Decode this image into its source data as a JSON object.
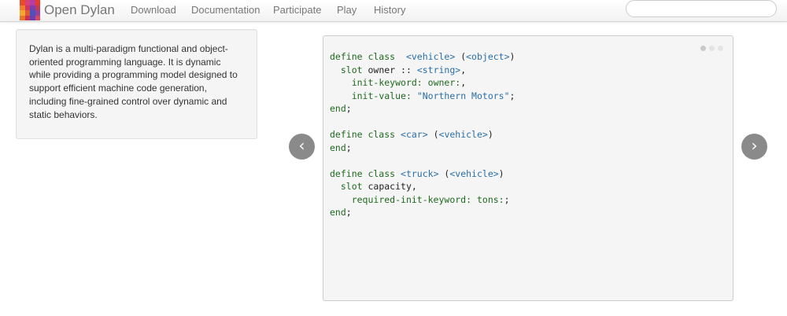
{
  "nav": {
    "brand": "Open Dylan",
    "links": [
      "Download",
      "Documentation",
      "Participate",
      "Play",
      "History"
    ],
    "search_placeholder": ""
  },
  "logo_colors": [
    "#e64b2c",
    "#d93f79",
    "#b43fa0",
    "#e8392d",
    "#f07c30",
    "#d2385e",
    "#7a3fae",
    "#c13c5a",
    "#f2a52f",
    "#e05a3a",
    "#4a54b4",
    "#9a3f9b",
    "#e7762a",
    "#c9334f",
    "#6d3fb5",
    "#d84863"
  ],
  "description": "Dylan is a multi-paradigm functional and object-oriented programming language. It is dynamic while providing a programming model designed to support efficient machine code generation, including fine-grained control over dynamic and static behaviors.",
  "code": {
    "lines": [
      [
        [
          "k",
          "define class"
        ],
        [
          "",
          "  "
        ],
        [
          "t",
          "<vehicle>"
        ],
        [
          "",
          " ("
        ],
        [
          "t",
          "<object>"
        ],
        [
          "",
          ")"
        ]
      ],
      [
        [
          "",
          "  "
        ],
        [
          "k",
          "slot"
        ],
        [
          "",
          " owner :: "
        ],
        [
          "t",
          "<string>"
        ],
        [
          "",
          ","
        ]
      ],
      [
        [
          "",
          "    "
        ],
        [
          "k",
          "init-keyword:"
        ],
        [
          "",
          " "
        ],
        [
          "k",
          "owner:"
        ],
        [
          "",
          ","
        ]
      ],
      [
        [
          "",
          "    "
        ],
        [
          "k",
          "init-value:"
        ],
        [
          "",
          " "
        ],
        [
          "s",
          "\"Northern Motors\""
        ],
        [
          "",
          ";"
        ]
      ],
      [
        [
          "k",
          "end"
        ],
        [
          "",
          ";"
        ]
      ],
      [
        [
          "",
          ""
        ]
      ],
      [
        [
          "k",
          "define class"
        ],
        [
          "",
          " "
        ],
        [
          "t",
          "<car>"
        ],
        [
          "",
          " ("
        ],
        [
          "t",
          "<vehicle>"
        ],
        [
          "",
          ")"
        ]
      ],
      [
        [
          "k",
          "end"
        ],
        [
          "",
          ";"
        ]
      ],
      [
        [
          "",
          ""
        ]
      ],
      [
        [
          "k",
          "define class"
        ],
        [
          "",
          " "
        ],
        [
          "t",
          "<truck>"
        ],
        [
          "",
          " ("
        ],
        [
          "t",
          "<vehicle>"
        ],
        [
          "",
          ")"
        ]
      ],
      [
        [
          "",
          "  "
        ],
        [
          "k",
          "slot"
        ],
        [
          "",
          " capacity,"
        ]
      ],
      [
        [
          "",
          "    "
        ],
        [
          "k",
          "required-init-keyword:"
        ],
        [
          "",
          " "
        ],
        [
          "k",
          "tons:"
        ],
        [
          "",
          ";"
        ]
      ],
      [
        [
          "k",
          "end"
        ],
        [
          "",
          ";"
        ]
      ]
    ]
  },
  "carousel": {
    "prev_icon": "‹",
    "next_icon": "›",
    "indicator_count": 3,
    "active_indicator": 0
  }
}
